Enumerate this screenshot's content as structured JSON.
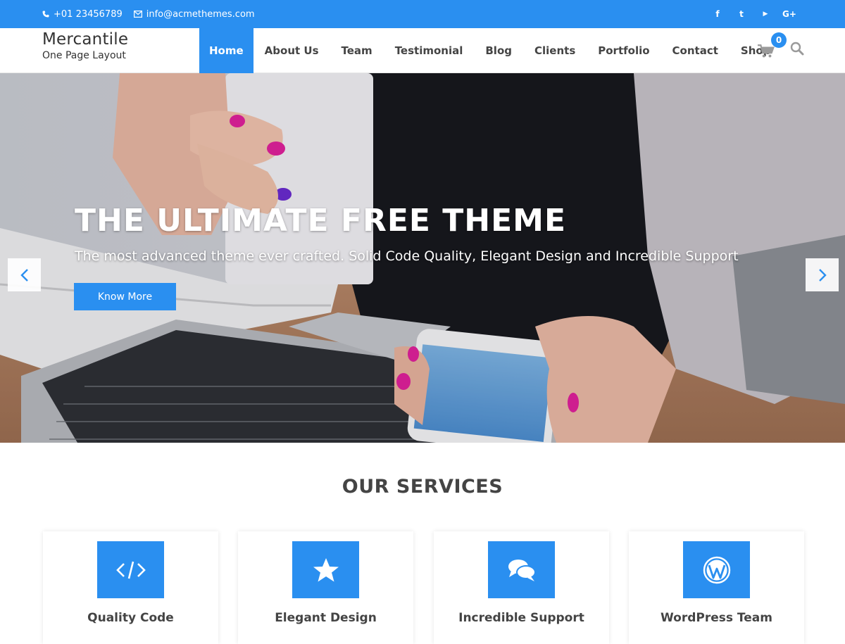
{
  "colors": {
    "accent": "#2a8ff0",
    "text": "#444444"
  },
  "topbar": {
    "phone": "+01 23456789",
    "email": "info@acmethemes.com",
    "social": [
      {
        "icon": "facebook-icon",
        "glyph": "f"
      },
      {
        "icon": "twitter-icon",
        "glyph": "t"
      },
      {
        "icon": "youtube-icon",
        "glyph": "▶"
      },
      {
        "icon": "google-plus-icon",
        "glyph": "G+"
      }
    ]
  },
  "brand": {
    "title": "Mercantile",
    "tagline": "One Page Layout"
  },
  "nav": {
    "items": [
      {
        "label": "Home",
        "active": true
      },
      {
        "label": "About Us"
      },
      {
        "label": "Team"
      },
      {
        "label": "Testimonial"
      },
      {
        "label": "Blog"
      },
      {
        "label": "Clients"
      },
      {
        "label": "Portfolio"
      },
      {
        "label": "Contact"
      },
      {
        "label": "Shop"
      }
    ],
    "cart_count": "0"
  },
  "hero": {
    "title": "THE ULTIMATE FREE THEME",
    "subtitle": "The most advanced theme ever crafted. Solid Code Quality, Elegant Design and Incredible Support",
    "button": "Know More"
  },
  "services": {
    "title": "OUR SERVICES",
    "items": [
      {
        "label": "Quality Code",
        "icon": "code-icon"
      },
      {
        "label": "Elegant Design",
        "icon": "star-icon"
      },
      {
        "label": "Incredible Support",
        "icon": "comments-icon"
      },
      {
        "label": "WordPress Team",
        "icon": "wordpress-icon"
      }
    ]
  }
}
